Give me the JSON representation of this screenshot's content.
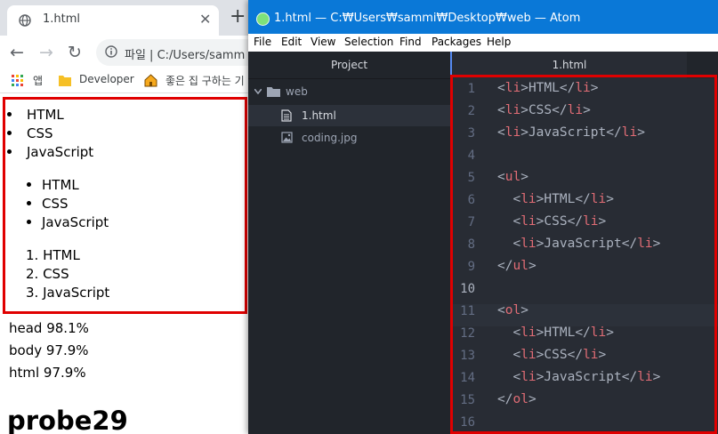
{
  "chrome": {
    "tab_title": "1.html",
    "tab_close": "✕",
    "new_tab": "+",
    "back_icon": "←",
    "forward_icon": "→",
    "reload_icon": "↻",
    "url_text": "파일 | C:/Users/samm",
    "bookmarks": [
      {
        "icon": "apps-grid-icon",
        "label": "앱"
      },
      {
        "icon": "folder-icon",
        "label": "Developer"
      },
      {
        "icon": "house-icon",
        "label": "좋은 집 구하는 기"
      }
    ],
    "content": {
      "list_plain": [
        "HTML",
        "CSS",
        "JavaScript"
      ],
      "list_ul": [
        "HTML",
        "CSS",
        "JavaScript"
      ],
      "list_ol": [
        "1. HTML",
        "2. CSS",
        "3. JavaScript"
      ],
      "stats": [
        "head 98.1%",
        "body 97.9%",
        "html  97.9%"
      ],
      "probe": "probe29"
    }
  },
  "atom": {
    "title": "1.html — C:₩Users₩sammi₩Desktop₩web — Atom",
    "menu": [
      "File",
      "Edit",
      "View",
      "Selection",
      "Find",
      "Packages",
      "Help"
    ],
    "tree": {
      "header": "Project",
      "folder": "web",
      "files": [
        "1.html",
        "coding.jpg"
      ],
      "selected": "1.html"
    },
    "editor_tab": "1.html",
    "cursor_line": 10,
    "code": [
      {
        "ln": "1",
        "indent": "",
        "tokens": [
          [
            "p",
            "<"
          ],
          [
            "t",
            "li"
          ],
          [
            "p",
            ">"
          ],
          [
            "x",
            "HTML"
          ],
          [
            "p",
            "</"
          ],
          [
            "t",
            "li"
          ],
          [
            "p",
            ">"
          ]
        ]
      },
      {
        "ln": "2",
        "indent": "",
        "tokens": [
          [
            "p",
            "<"
          ],
          [
            "t",
            "li"
          ],
          [
            "p",
            ">"
          ],
          [
            "x",
            "CSS"
          ],
          [
            "p",
            "</"
          ],
          [
            "t",
            "li"
          ],
          [
            "p",
            ">"
          ]
        ]
      },
      {
        "ln": "3",
        "indent": "",
        "tokens": [
          [
            "p",
            "<"
          ],
          [
            "t",
            "li"
          ],
          [
            "p",
            ">"
          ],
          [
            "x",
            "JavaScript"
          ],
          [
            "p",
            "</"
          ],
          [
            "t",
            "li"
          ],
          [
            "p",
            ">"
          ]
        ]
      },
      {
        "ln": "4",
        "indent": "",
        "tokens": []
      },
      {
        "ln": "5",
        "indent": "",
        "tokens": [
          [
            "p",
            "<"
          ],
          [
            "t",
            "ul"
          ],
          [
            "p",
            ">"
          ]
        ]
      },
      {
        "ln": "6",
        "indent": "  ",
        "tokens": [
          [
            "p",
            "<"
          ],
          [
            "t",
            "li"
          ],
          [
            "p",
            ">"
          ],
          [
            "x",
            "HTML"
          ],
          [
            "p",
            "</"
          ],
          [
            "t",
            "li"
          ],
          [
            "p",
            ">"
          ]
        ]
      },
      {
        "ln": "7",
        "indent": "  ",
        "tokens": [
          [
            "p",
            "<"
          ],
          [
            "t",
            "li"
          ],
          [
            "p",
            ">"
          ],
          [
            "x",
            "CSS"
          ],
          [
            "p",
            "</"
          ],
          [
            "t",
            "li"
          ],
          [
            "p",
            ">"
          ]
        ]
      },
      {
        "ln": "8",
        "indent": "  ",
        "tokens": [
          [
            "p",
            "<"
          ],
          [
            "t",
            "li"
          ],
          [
            "p",
            ">"
          ],
          [
            "x",
            "JavaScript"
          ],
          [
            "p",
            "</"
          ],
          [
            "t",
            "li"
          ],
          [
            "p",
            ">"
          ]
        ]
      },
      {
        "ln": "9",
        "indent": "",
        "tokens": [
          [
            "p",
            "</"
          ],
          [
            "t",
            "ul"
          ],
          [
            "p",
            ">"
          ]
        ]
      },
      {
        "ln": "10",
        "indent": "",
        "tokens": []
      },
      {
        "ln": "11",
        "indent": "",
        "tokens": [
          [
            "p",
            "<"
          ],
          [
            "t",
            "ol"
          ],
          [
            "p",
            ">"
          ]
        ]
      },
      {
        "ln": "12",
        "indent": "  ",
        "tokens": [
          [
            "p",
            "<"
          ],
          [
            "t",
            "li"
          ],
          [
            "p",
            ">"
          ],
          [
            "x",
            "HTML"
          ],
          [
            "p",
            "</"
          ],
          [
            "t",
            "li"
          ],
          [
            "p",
            ">"
          ]
        ]
      },
      {
        "ln": "13",
        "indent": "  ",
        "tokens": [
          [
            "p",
            "<"
          ],
          [
            "t",
            "li"
          ],
          [
            "p",
            ">"
          ],
          [
            "x",
            "CSS"
          ],
          [
            "p",
            "</"
          ],
          [
            "t",
            "li"
          ],
          [
            "p",
            ">"
          ]
        ]
      },
      {
        "ln": "14",
        "indent": "  ",
        "tokens": [
          [
            "p",
            "<"
          ],
          [
            "t",
            "li"
          ],
          [
            "p",
            ">"
          ],
          [
            "x",
            "JavaScript"
          ],
          [
            "p",
            "</"
          ],
          [
            "t",
            "li"
          ],
          [
            "p",
            ">"
          ]
        ]
      },
      {
        "ln": "15",
        "indent": "",
        "tokens": [
          [
            "p",
            "</"
          ],
          [
            "t",
            "ol"
          ],
          [
            "p",
            ">"
          ]
        ]
      },
      {
        "ln": "16",
        "indent": "",
        "tokens": []
      }
    ]
  },
  "colors": {
    "highlight_box": "#e00000",
    "atom_titlebar": "#0a78d7",
    "tag": "#e06c75",
    "text": "#abb2bf"
  }
}
